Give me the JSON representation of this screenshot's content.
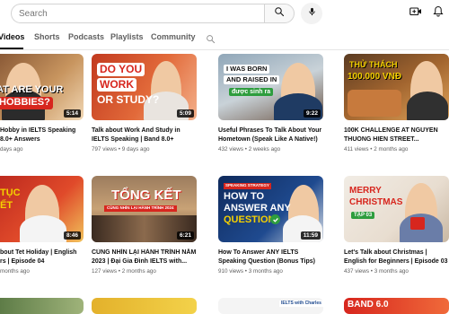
{
  "search": {
    "placeholder": "Search"
  },
  "header": {
    "icons": [
      "search-icon",
      "microphone-icon",
      "create-video-icon",
      "bell-icon"
    ]
  },
  "tabs": [
    {
      "label": "Videos",
      "active": true
    },
    {
      "label": "Shorts",
      "active": false
    },
    {
      "label": "Podcasts",
      "active": false
    },
    {
      "label": "Playlists",
      "active": false
    },
    {
      "label": "Community",
      "active": false
    }
  ],
  "videos": [
    {
      "title": "Hobby in IELTS Speaking 8.0+ Answers",
      "views": "",
      "age": "days ago",
      "duration": "5:14",
      "thumb_text": [
        "AT ARE YOUR",
        "HOBBIES?"
      ]
    },
    {
      "title": "Talk about Work And Study in IELTS Speaking | Band 8.0+ Sample...",
      "views": "797 views",
      "age": "9 days ago",
      "duration": "5:09",
      "thumb_text": [
        "DO YOU",
        "WORK",
        "OR STUDY?"
      ]
    },
    {
      "title": "Useful Phrases To Talk About Your Hometown (Speak Like A Native!)",
      "views": "432 views",
      "age": "2 weeks ago",
      "duration": "9:22",
      "thumb_text": [
        "I WAS BORN",
        "AND RAISED IN",
        "được sinh ra"
      ]
    },
    {
      "title": "100K CHALLENGE AT NGUYEN THUONG HIEN STREET...",
      "views": "411 views",
      "age": "2 months ago",
      "duration": "",
      "thumb_text": [
        "THỬ THÁCH",
        "100.000 VNĐ"
      ]
    },
    {
      "title": "bout Tet Holiday | English rs | Episode 04",
      "views": "",
      "age": "months ago",
      "duration": "8:46",
      "thumb_text": [
        "TỤC",
        "ẾT"
      ]
    },
    {
      "title": "CÙNG NHÌN LẠI HÀNH TRÌNH NĂM 2023 | Đại Gia Đình IELTS with...",
      "views": "127 views",
      "age": "2 months ago",
      "duration": "6:21",
      "thumb_text": [
        "TỔNG KẾT",
        "CÙNG NHÌN LẠI HÀNH TRÌNH 2024"
      ]
    },
    {
      "title": "How To Answer ANY IELTS Speaking Question (Bonus Tips)",
      "views": "910 views",
      "age": "3 months ago",
      "duration": "11:59",
      "thumb_text": [
        "SPEAKING STRATEGY",
        "HOW TO",
        "ANSWER ANY",
        "QUESTION"
      ]
    },
    {
      "title": "Let's Talk about Christmas | English for Beginners | Episode 03",
      "views": "437 views",
      "age": "3 months ago",
      "duration": "",
      "thumb_text": [
        "MERRY",
        "CHRISTMAS",
        "TẬP 03"
      ]
    }
  ],
  "bottom_row_thumb_text": [
    "IELTS with Charles",
    "BAND 6.0"
  ],
  "colors": {
    "accent_yellow": "#f5d000",
    "accent_red": "#d7261e",
    "accent_green": "#2e9d3e"
  }
}
